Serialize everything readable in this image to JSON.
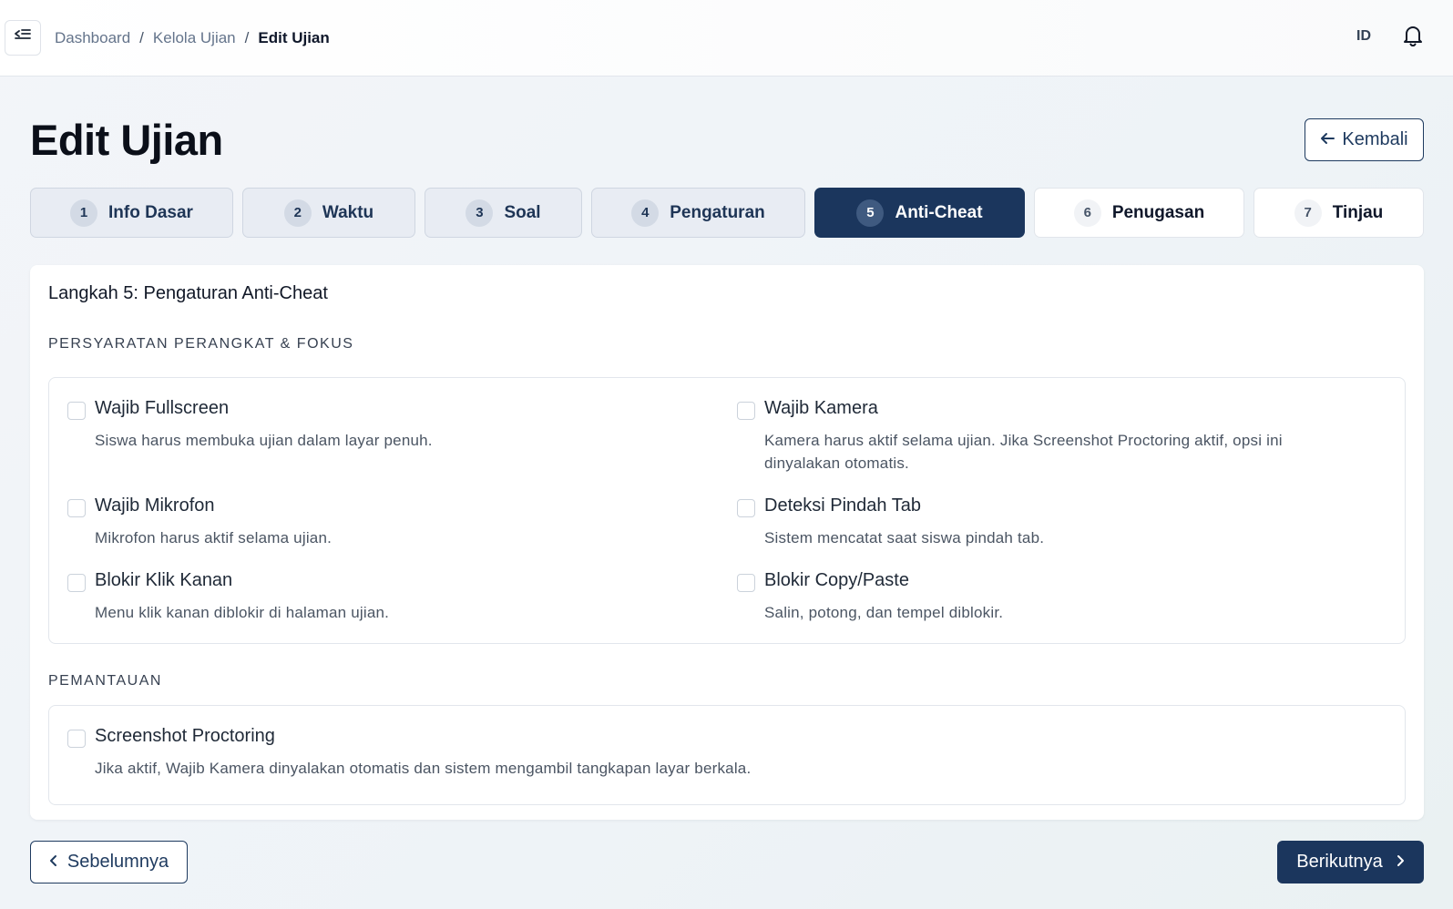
{
  "breadcrumb": {
    "home": "Dashboard",
    "parent": "Kelola Ujian",
    "current": "Edit Ujian",
    "separator": "/"
  },
  "header": {
    "language": "ID",
    "menu_icon": "menu-collapse-icon",
    "notification_icon": "bell-icon"
  },
  "page": {
    "title": "Edit Ujian",
    "back_label": "Kembali",
    "back_icon": "arrow-left-icon"
  },
  "steps": [
    {
      "num": "1",
      "label": "Info Dasar",
      "state": "done"
    },
    {
      "num": "2",
      "label": "Waktu",
      "state": "done"
    },
    {
      "num": "3",
      "label": "Soal",
      "state": "done"
    },
    {
      "num": "4",
      "label": "Pengaturan",
      "state": "done"
    },
    {
      "num": "5",
      "label": "Anti-Cheat",
      "state": "active"
    },
    {
      "num": "6",
      "label": "Penugasan",
      "state": "todo"
    },
    {
      "num": "7",
      "label": "Tinjau",
      "state": "todo"
    }
  ],
  "card": {
    "title": "Langkah 5: Pengaturan Anti-Cheat",
    "section_device": "PERSYARATAN PERANGKAT & FOKUS",
    "section_monitor": "PEMANTAUAN"
  },
  "options": {
    "fullscreen": {
      "label": "Wajib Fullscreen",
      "desc": "Siswa harus membuka ujian dalam layar penuh.",
      "checked": false
    },
    "camera": {
      "label": "Wajib Kamera",
      "desc": "Kamera harus aktif selama ujian. Jika Screenshot Proctoring aktif, opsi ini dinyalakan otomatis.",
      "checked": false
    },
    "microphone": {
      "label": "Wajib Mikrofon",
      "desc": "Mikrofon harus aktif selama ujian.",
      "checked": false
    },
    "tab_switch": {
      "label": "Deteksi Pindah Tab",
      "desc": "Sistem mencatat saat siswa pindah tab.",
      "checked": false
    },
    "right_click": {
      "label": "Blokir Klik Kanan",
      "desc": "Menu klik kanan diblokir di halaman ujian.",
      "checked": false
    },
    "copy_paste": {
      "label": "Blokir Copy/Paste",
      "desc": "Salin, potong, dan tempel diblokir.",
      "checked": false
    },
    "screenshot": {
      "label": "Screenshot Proctoring",
      "desc": "Jika aktif, Wajib Kamera dinyalakan otomatis dan sistem mengambil tangkapan layar berkala.",
      "checked": false
    }
  },
  "footer": {
    "prev_label": "Sebelumnya",
    "next_label": "Berikutnya",
    "prev_icon": "chevron-left-icon",
    "next_icon": "chevron-right-icon"
  },
  "colors": {
    "primary": "#1b365d",
    "step_done_bg": "#e8ecf3",
    "page_bg": "#f3f5f9"
  }
}
